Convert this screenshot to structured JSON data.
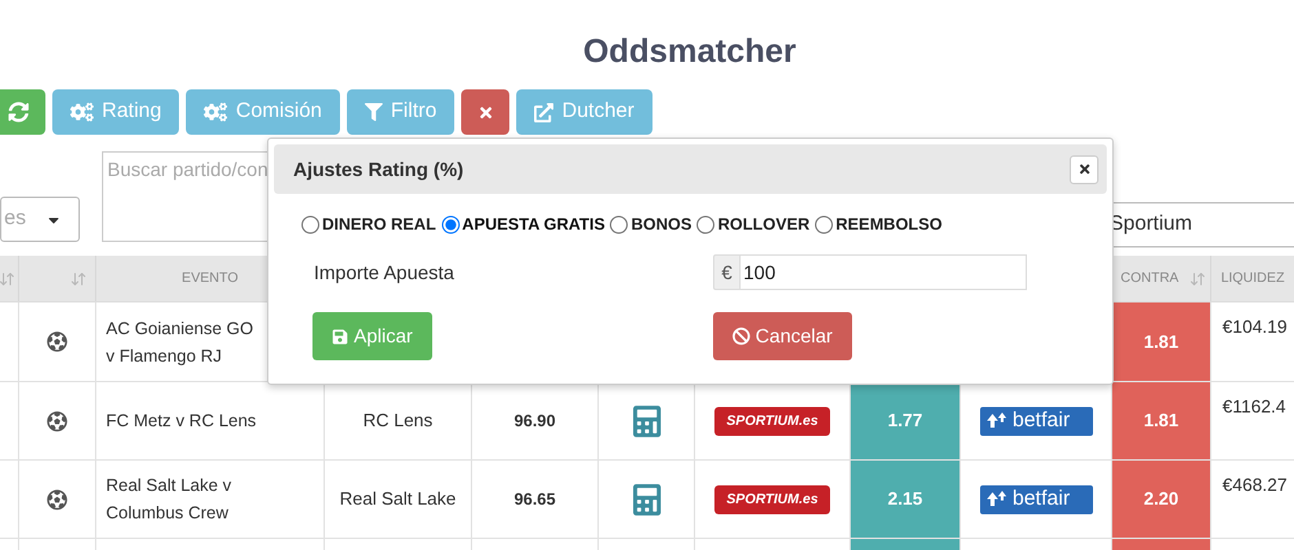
{
  "title": "Oddsmatcher",
  "toolbar": [
    {
      "kind": "refresh"
    },
    {
      "kind": "settings",
      "label": "Rating"
    },
    {
      "kind": "settings",
      "label": "Comisión"
    },
    {
      "kind": "filter",
      "label": "Filtro"
    },
    {
      "kind": "clear"
    },
    {
      "kind": "external",
      "label": "Dutcher"
    }
  ],
  "filters": {
    "sport_placeholder": "es",
    "search_placeholder": "Buscar partido/con",
    "bookmaker": "Sportium"
  },
  "table": {
    "columns": [
      {
        "sortable": true
      },
      {
        "sortable": true
      },
      {
        "label": "EVENTO",
        "sortable": false
      },
      {},
      {},
      {},
      {},
      {},
      {},
      {
        "label": "CONTRA",
        "sortable": true
      },
      {
        "label": "LIQUIDEZ",
        "sortable": false
      }
    ],
    "rows": [
      {
        "event": "AC Goianiense GO v Flamengo RJ",
        "lay_odds": "1.81",
        "liquidity": "€104.19"
      },
      {
        "event": "FC Metz v RC Lens",
        "selection": "RC Lens",
        "rating": "96.90",
        "bookmaker": "SPORTIUM.es",
        "back_odds": "1.77",
        "exchange": "betfair",
        "lay_odds": "1.81",
        "liquidity": "€1162.4"
      },
      {
        "event": "Real Salt Lake v Columbus Crew",
        "selection": "Real Salt Lake",
        "rating": "96.65",
        "bookmaker": "SPORTIUM.es",
        "back_odds": "2.15",
        "exchange": "betfair",
        "lay_odds": "2.20",
        "liquidity": "€468.27"
      },
      {}
    ]
  },
  "popover": {
    "title": "Ajustes Rating (%)",
    "options": [
      {
        "label": "DINERO REAL",
        "selected": false
      },
      {
        "label": "APUESTA GRATIS",
        "selected": true
      },
      {
        "label": "BONOS",
        "selected": false
      },
      {
        "label": "ROLLOVER",
        "selected": false
      },
      {
        "label": "REEMBOLSO",
        "selected": false
      }
    ],
    "amount": {
      "label": "Importe Apuesta",
      "currency": "€",
      "value": "100"
    },
    "buttons": [
      {
        "kind": "apply",
        "label": "Aplicar"
      },
      {
        "kind": "cancel",
        "label": "Cancelar"
      }
    ]
  }
}
